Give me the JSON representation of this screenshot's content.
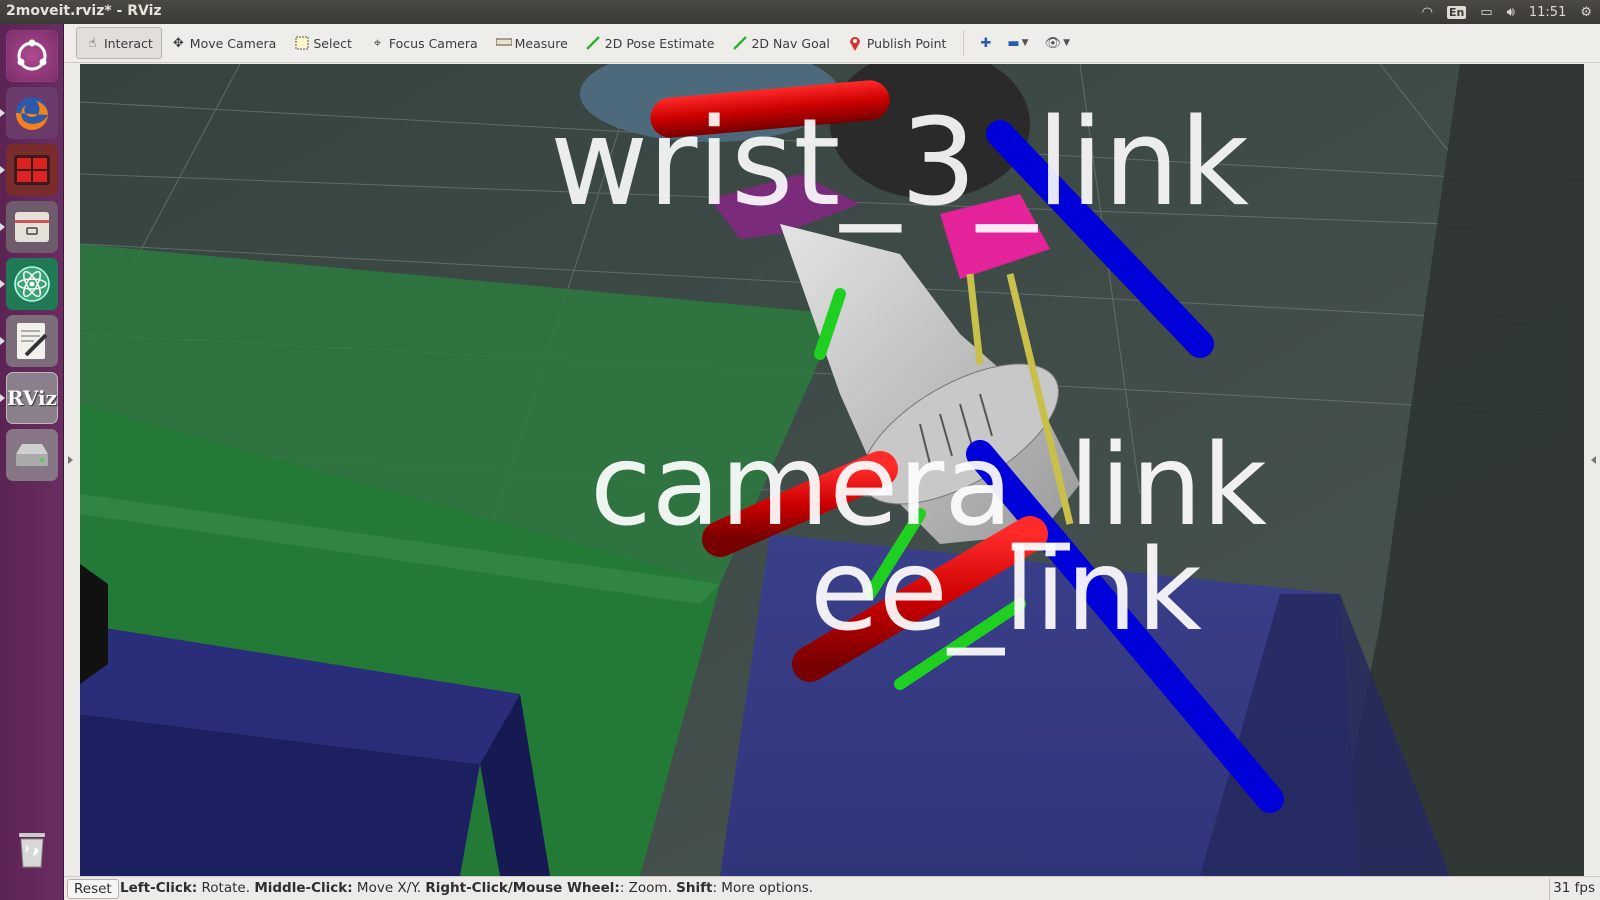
{
  "window": {
    "title": "2moveit.rviz* - RViz"
  },
  "tray": {
    "lang": "En",
    "time": "11:51"
  },
  "toolbar": {
    "tools": [
      {
        "label": "Interact",
        "icon": "hand-icon",
        "active": true
      },
      {
        "label": "Move Camera",
        "icon": "move-camera-icon"
      },
      {
        "label": "Select",
        "icon": "select-icon"
      },
      {
        "label": "Focus Camera",
        "icon": "focus-camera-icon"
      },
      {
        "label": "Measure",
        "icon": "measure-icon"
      },
      {
        "label": "2D Pose Estimate",
        "icon": "pose-estimate-icon"
      },
      {
        "label": "2D Nav Goal",
        "icon": "nav-goal-icon"
      },
      {
        "label": "Publish Point",
        "icon": "map-pin-icon"
      }
    ]
  },
  "viewport": {
    "labels": {
      "wrist": "wrist_3_link",
      "camera": "camera_link",
      "ee": "ee_link"
    }
  },
  "status": {
    "reset_label": "Reset",
    "left_click_key": "Left-Click:",
    "left_click_desc": " Rotate. ",
    "middle_click_key": "Middle-Click:",
    "middle_click_desc": " Move X/Y. ",
    "right_click_key": "Right-Click/Mouse Wheel:",
    "right_click_desc": ": Zoom. ",
    "shift_key": "Shift",
    "shift_desc": ": More options.",
    "fps": "31 fps"
  }
}
